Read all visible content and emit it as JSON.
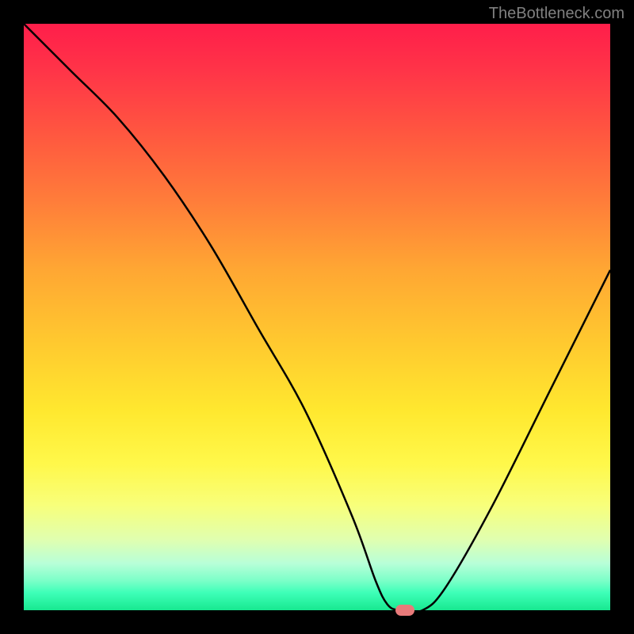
{
  "watermark": "TheBottleneck.com",
  "chart_data": {
    "type": "line",
    "title": "",
    "xlabel": "",
    "ylabel": "",
    "xlim": [
      0,
      100
    ],
    "ylim": [
      0,
      100
    ],
    "series": [
      {
        "name": "bottleneck-curve",
        "x": [
          0,
          8,
          16,
          24,
          32,
          40,
          48,
          56,
          60,
          62,
          64,
          68,
          72,
          80,
          90,
          100
        ],
        "y": [
          100,
          92,
          84,
          74,
          62,
          48,
          34,
          16,
          5,
          1,
          0,
          0,
          4,
          18,
          38,
          58
        ]
      }
    ],
    "marker": {
      "name": "optimal-point",
      "x": 65,
      "y": 0,
      "color": "#e87a7a"
    },
    "background_gradient": {
      "top": "#ff1e4a",
      "middle": "#ffe82f",
      "bottom": "#18e890"
    }
  }
}
